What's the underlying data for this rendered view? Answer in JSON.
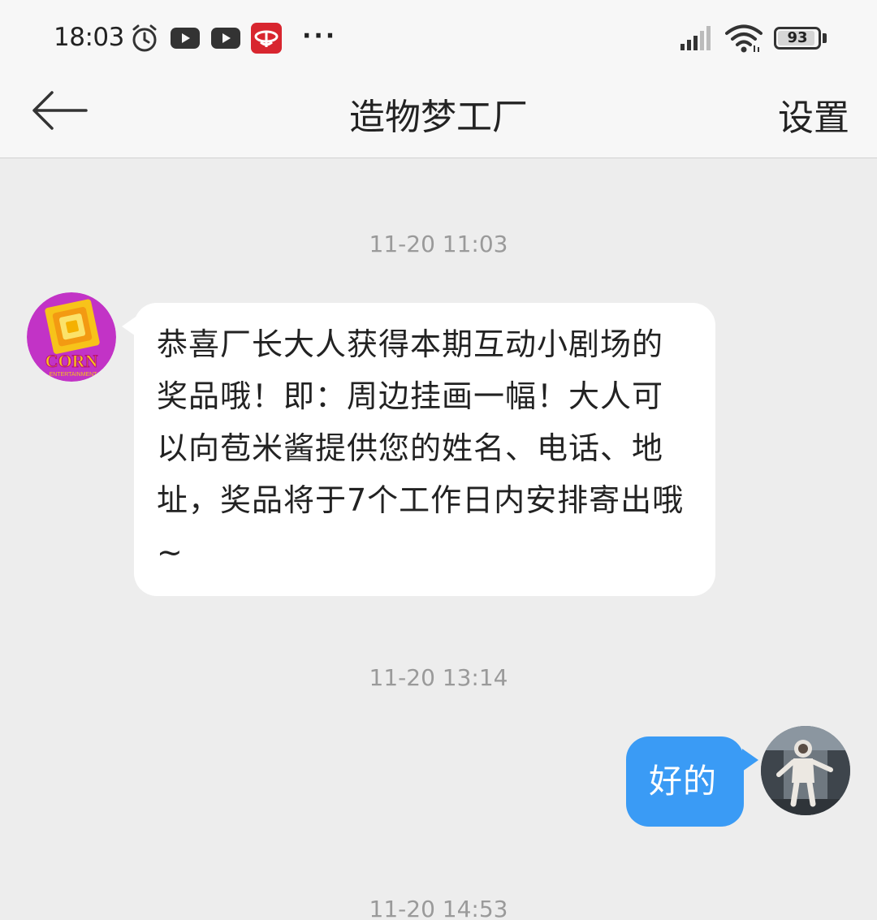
{
  "status_bar": {
    "time": "18:03",
    "more_indicator": "···",
    "battery_level": "93",
    "battery_fraction": 0.93,
    "icons": [
      "alarm-icon",
      "youtube-icon",
      "youtube-icon",
      "app-notification-icon",
      "signal-icon",
      "wifi-icon",
      "battery-icon"
    ]
  },
  "nav": {
    "back_icon": "arrow-left-icon",
    "title": "造物梦工厂",
    "settings_label": "设置"
  },
  "messages": [
    {
      "timestamp": "11-20 11:03",
      "direction": "incoming",
      "sender_avatar": "corn-entertainment-logo",
      "text": "恭喜厂长大人获得本期互动小剧场的奖品哦！即：周边挂画一幅！大人可以向苞米酱提供您的姓名、电话、地址，奖品将于7个工作日内安排寄出哦~"
    },
    {
      "timestamp": "11-20 13:14",
      "direction": "outgoing",
      "sender_avatar": "astronaut-photo",
      "text": "好的"
    },
    {
      "timestamp": "11-20 14:53"
    }
  ],
  "colors": {
    "background": "#ededed",
    "header": "#f7f7f7",
    "incoming_bubble": "#ffffff",
    "outgoing_bubble": "#3a9bf5",
    "timestamp": "#9a9a9a"
  },
  "avatar_logo_text": "CORN ENTERTAINMENT"
}
